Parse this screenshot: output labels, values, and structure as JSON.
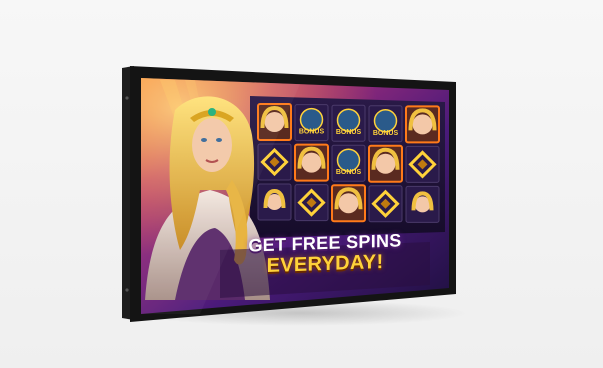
{
  "promo": {
    "headline_line1": "GET FREE SPINS",
    "headline_line2": "EVERYDAY!",
    "bonus_label": "BONUS"
  },
  "reels": {
    "symbols": [
      [
        "queen",
        "bonus",
        "bonus",
        "bonus",
        "queen"
      ],
      [
        "diamond",
        "queen",
        "bonus",
        "queen",
        "diamond"
      ],
      [
        "queen-small",
        "diamond",
        "queen",
        "diamond",
        "queen-small"
      ]
    ]
  },
  "colors": {
    "gold": "#ffd23a",
    "frame_orange": "#ff7a1a",
    "screen_purple": "#3a1450",
    "bezel": "#1a1a1a"
  }
}
